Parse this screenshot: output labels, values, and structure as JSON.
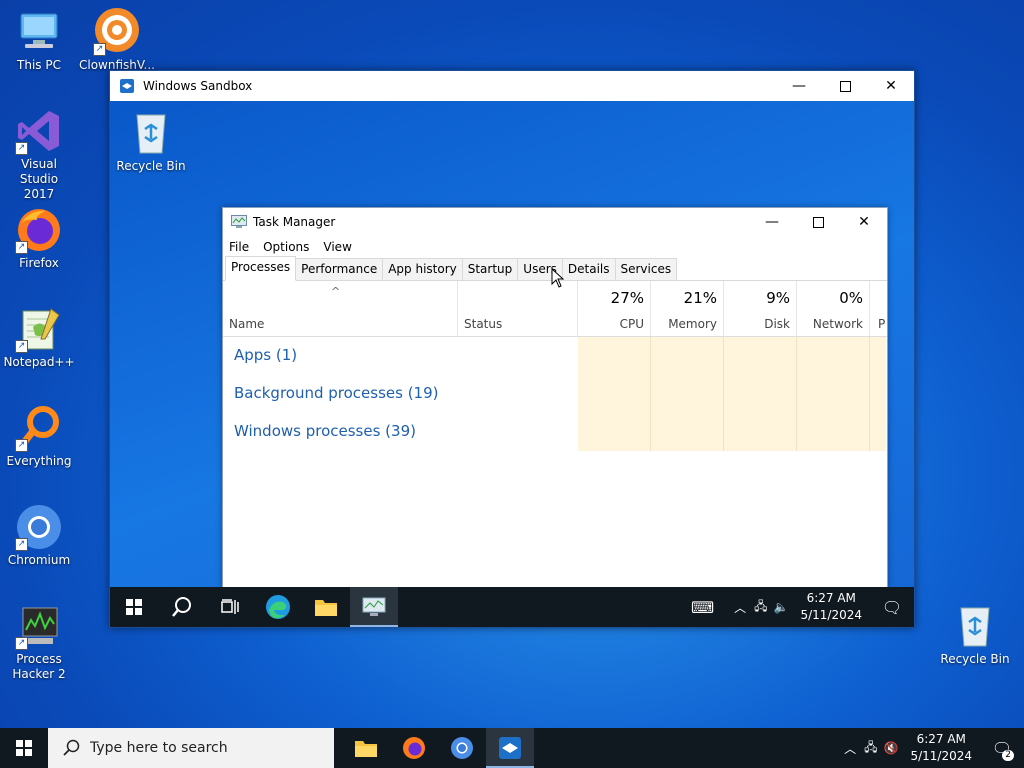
{
  "desktop_icons": [
    {
      "label": "This PC",
      "icon": "this-pc-icon"
    },
    {
      "label": "ClownfishV...",
      "icon": "clownfish-icon"
    },
    {
      "label": "Visual Studio 2017",
      "icon": "visual-studio-icon"
    },
    {
      "label": "Firefox",
      "icon": "firefox-icon"
    },
    {
      "label": "Notepad++",
      "icon": "notepadpp-icon"
    },
    {
      "label": "Everything",
      "icon": "everything-icon"
    },
    {
      "label": "Chromium",
      "icon": "chromium-icon"
    },
    {
      "label": "Process Hacker 2",
      "icon": "process-hacker-icon"
    },
    {
      "label": "Recycle Bin",
      "icon": "recycle-bin-icon"
    }
  ],
  "sandbox": {
    "title": "Windows Sandbox",
    "desktop_icon_label": "Recycle Bin",
    "taskbar": {
      "time": "6:27 AM",
      "date": "5/11/2024"
    }
  },
  "task_manager": {
    "title": "Task Manager",
    "menu": [
      "File",
      "Options",
      "View"
    ],
    "tabs": [
      "Processes",
      "Performance",
      "App history",
      "Startup",
      "Users",
      "Details",
      "Services"
    ],
    "active_tab": "Processes",
    "columns": {
      "name": "Name",
      "status": "Status",
      "cpu": {
        "pct": "27%",
        "label": "CPU"
      },
      "memory": {
        "pct": "21%",
        "label": "Memory"
      },
      "disk": {
        "pct": "9%",
        "label": "Disk"
      },
      "network": {
        "pct": "0%",
        "label": "Network"
      },
      "power": "P"
    },
    "groups": [
      "Apps (1)",
      "Background processes (19)",
      "Windows processes (39)"
    ]
  },
  "taskbar": {
    "search_placeholder": "Type here to search",
    "time": "6:27 AM",
    "date": "5/11/2024",
    "notification_count": "2"
  }
}
